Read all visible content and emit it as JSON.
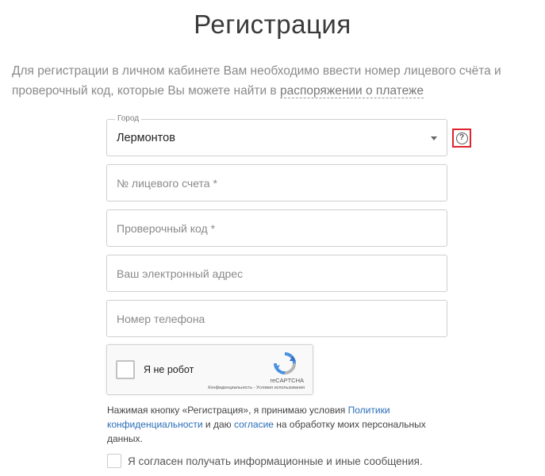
{
  "page": {
    "title": "Регистрация",
    "intro_text": "Для регистрации в личном кабинете Вам необходимо ввести номер лицевого счёта и проверочный код, которые Вы можете найти в ",
    "intro_link": "распоряжении о платеже"
  },
  "form": {
    "city": {
      "label": "Город",
      "value": "Лермонтов",
      "help_icon": "question-circle-icon"
    },
    "account": {
      "placeholder": "№ лицевого счета *",
      "value": ""
    },
    "code": {
      "placeholder": "Проверочный код *",
      "value": ""
    },
    "email": {
      "placeholder": "Ваш электронный адрес",
      "value": ""
    },
    "phone": {
      "placeholder": "Номер телефона",
      "value": ""
    }
  },
  "captcha": {
    "label": "Я не робот",
    "brand": "reCAPTCHA",
    "privacy": "Конфиденциальность",
    "separator": " - ",
    "terms": "Условия использования"
  },
  "consent": {
    "part1": "Нажимая кнопку «Регистрация», я принимаю условия ",
    "link1": "Политики конфиденциальности",
    "part2": " и даю ",
    "link2": "согласие",
    "part3": " на обработку моих персональных данных."
  },
  "agree": {
    "label": "Я согласен получать информационные и иные сообщения.",
    "checked": false
  },
  "colors": {
    "highlight": "#e0242b",
    "link": "#2a6db8",
    "recaptcha_blue": "#4a90e2",
    "recaptcha_gray": "#b5b5b5"
  }
}
